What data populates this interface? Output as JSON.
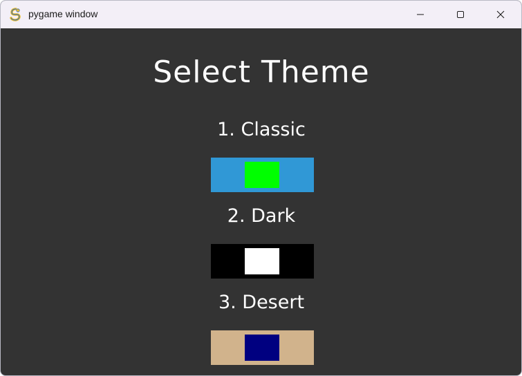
{
  "window": {
    "title": "pygame window",
    "icon": "pygame-snake-icon"
  },
  "controls": {
    "minimize_icon": "minimize-icon",
    "maximize_icon": "maximize-icon",
    "close_icon": "close-icon"
  },
  "screen": {
    "heading": "Select Theme",
    "background_color": "#333333",
    "themes": [
      {
        "label": "1. Classic",
        "outer_color": "#3098d6",
        "inner_color": "#00ff00"
      },
      {
        "label": "2. Dark",
        "outer_color": "#000000",
        "inner_color": "#ffffff"
      },
      {
        "label": "3. Desert",
        "outer_color": "#d1b38c",
        "inner_color": "#000080"
      }
    ]
  }
}
